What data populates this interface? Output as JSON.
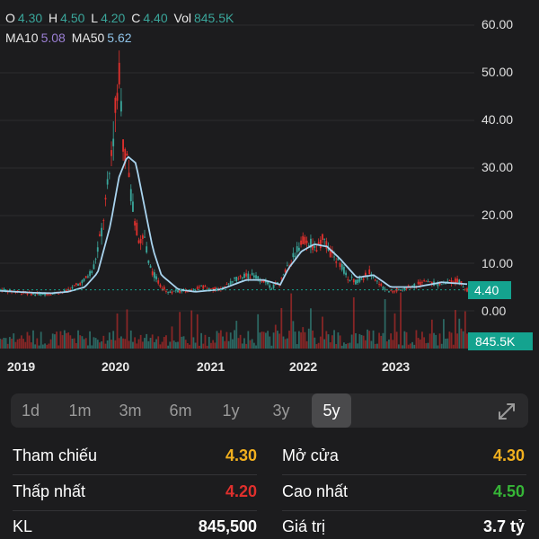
{
  "legend": {
    "open_label": "O",
    "open_value": "4.30",
    "high_label": "H",
    "high_value": "4.50",
    "low_label": "L",
    "low_value": "4.20",
    "close_label": "C",
    "close_value": "4.40",
    "vol_label": "Vol",
    "vol_value": "845.5K",
    "ma10_label": "MA10",
    "ma10_value": "5.08",
    "ma50_label": "MA50",
    "ma50_value": "5.62"
  },
  "chart_data": {
    "type": "line",
    "y_ticks": [
      "60.00",
      "50.00",
      "40.00",
      "30.00",
      "20.00",
      "10.00",
      "0.00"
    ],
    "ylim": [
      0,
      60
    ],
    "x_ticks": [
      "2019",
      "2020",
      "2021",
      "2022",
      "2023"
    ],
    "current_price": "4.40",
    "current_volume": "845.5K",
    "series": [
      {
        "name": "MA50",
        "x": [
          2018.4,
          2018.8,
          2019.0,
          2019.2,
          2019.4,
          2019.55,
          2019.7,
          2019.8,
          2019.9,
          2020.0,
          2020.1,
          2020.2,
          2020.3,
          2020.5,
          2020.7,
          2021.0,
          2021.3,
          2021.5,
          2021.7,
          2021.8,
          2021.95,
          2022.1,
          2022.25,
          2022.4,
          2022.6,
          2022.8,
          2023.0,
          2023.3,
          2023.6,
          2023.9
        ],
        "values": [
          4.2,
          3.8,
          3.7,
          4.0,
          5.0,
          8.0,
          18.0,
          28.0,
          32.5,
          31.0,
          22.0,
          13.0,
          7.5,
          4.5,
          4.0,
          4.5,
          6.5,
          6.5,
          5.5,
          9.0,
          12.5,
          14.0,
          13.5,
          11.0,
          7.0,
          7.5,
          5.0,
          5.0,
          6.0,
          5.6
        ]
      },
      {
        "name": "Price",
        "x": [
          2018.4,
          2018.8,
          2019.0,
          2019.2,
          2019.4,
          2019.5,
          2019.6,
          2019.7,
          2019.75,
          2019.8,
          2019.85,
          2019.9,
          2019.95,
          2020.0,
          2020.05,
          2020.1,
          2020.15,
          2020.2,
          2020.3,
          2020.4,
          2020.6,
          2020.8,
          2021.0,
          2021.2,
          2021.4,
          2021.6,
          2021.7,
          2021.8,
          2021.9,
          2022.0,
          2022.1,
          2022.2,
          2022.3,
          2022.4,
          2022.5,
          2022.6,
          2022.75,
          2022.9,
          2023.0,
          2023.2,
          2023.4,
          2023.6,
          2023.8,
          2023.9
        ],
        "values": [
          4.5,
          3.5,
          3.6,
          4.2,
          6.5,
          9.0,
          17.0,
          30.0,
          40.0,
          53.0,
          36.0,
          30.0,
          24.0,
          18.0,
          14.0,
          16.0,
          10.0,
          8.0,
          5.0,
          4.0,
          4.2,
          5.0,
          4.5,
          7.0,
          7.5,
          5.0,
          6.0,
          9.5,
          13.0,
          15.5,
          13.0,
          15.0,
          12.0,
          10.0,
          7.0,
          6.0,
          8.0,
          5.0,
          4.0,
          5.0,
          6.0,
          5.5,
          6.5,
          4.4
        ]
      }
    ]
  },
  "tabs": [
    "1d",
    "1m",
    "3m",
    "6m",
    "1y",
    "3y",
    "5y"
  ],
  "active_tab": "5y",
  "stats": {
    "ref_label": "Tham chiếu",
    "ref_value": "4.30",
    "open_label": "Mở cửa",
    "open_value": "4.30",
    "low_label": "Thấp nhất",
    "low_value": "4.20",
    "high_label": "Cao nhất",
    "high_value": "4.50",
    "vol_label": "KL",
    "vol_value": "845,500",
    "value_label": "Giá trị",
    "value_value": "3.7 tỷ"
  },
  "colors": {
    "up": "#3aa69b",
    "down": "#e0302d",
    "ma50": "#a9d4ef",
    "ref": "#f2b01e",
    "accent": "#14a38f"
  },
  "icons": {
    "expand": "expand-arrows-icon"
  }
}
